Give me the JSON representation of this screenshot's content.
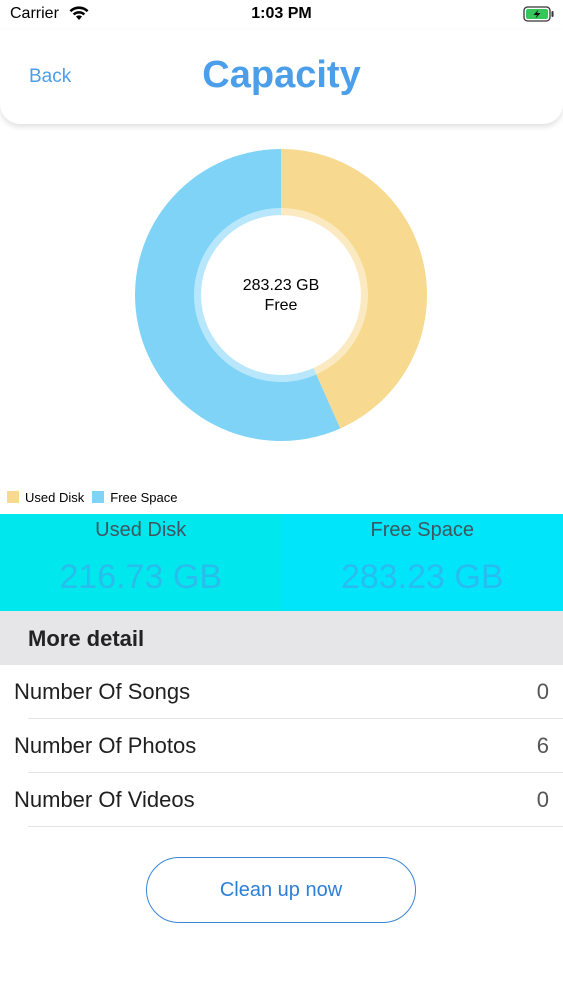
{
  "status_bar": {
    "carrier": "Carrier",
    "time": "1:03 PM"
  },
  "nav": {
    "back_label": "Back",
    "title": "Capacity"
  },
  "chart_data": {
    "type": "pie",
    "categories": [
      "Used Disk",
      "Free Space"
    ],
    "values": [
      216.73,
      283.23
    ],
    "units": "GB",
    "center_text": [
      "283.23 GB",
      "Free"
    ],
    "colors": [
      "#f7d98f",
      "#7fd3f7"
    ],
    "legend_position": "bottom-left"
  },
  "summary": {
    "used_label": "Used Disk",
    "used_value": "216.73 GB",
    "free_label": "Free Space",
    "free_value": "283.23 GB"
  },
  "detail": {
    "header": "More detail",
    "rows": [
      {
        "label": "Number Of Songs",
        "value": "0"
      },
      {
        "label": "Number Of Photos",
        "value": "6"
      },
      {
        "label": "Number Of Videos",
        "value": "0"
      }
    ]
  },
  "cleanup_button": "Clean up now",
  "colors": {
    "accent": "#4a9eea",
    "used": "#f7d98f",
    "free": "#7fd3f7",
    "summary_bg": "#00e7ee"
  }
}
